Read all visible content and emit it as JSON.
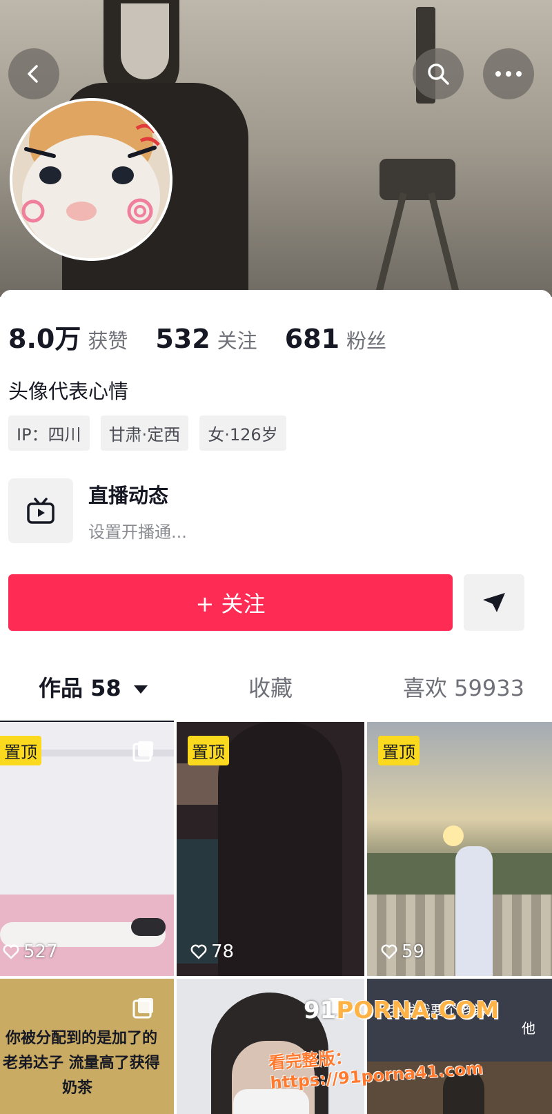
{
  "header": {
    "back_icon": "chevron-left-icon",
    "search_icon": "search-icon",
    "more_icon": "more-horizontal-icon"
  },
  "profile": {
    "stats": [
      {
        "value": "8.0万",
        "label": "获赞"
      },
      {
        "value": "532",
        "label": "关注"
      },
      {
        "value": "681",
        "label": "粉丝"
      }
    ],
    "bio": "头像代表心情",
    "tags": [
      "IP：四川",
      "甘肃·定西",
      "女·126岁"
    ]
  },
  "live": {
    "icon": "tv-icon",
    "title": "直播动态",
    "subtitle": "设置开播通..."
  },
  "actions": {
    "follow_label": "+ 关注",
    "share_icon": "send-icon"
  },
  "tabs": {
    "works": "作品 58",
    "favorites": "收藏",
    "likes": "喜欢 59933"
  },
  "grid": {
    "pin_label": "置顶",
    "tiles": [
      {
        "likes": "527"
      },
      {
        "likes": "78"
      },
      {
        "likes": "59"
      }
    ],
    "row2_overlay": [
      "你被分配到的是加了的",
      "老弟达子 流量高了获得",
      "奶茶"
    ],
    "row2_tile3_overlay": [
      "我发我要个老弟，",
      "他"
    ]
  },
  "watermark": {
    "site_prefix": "91",
    "site": "PORNA.COM",
    "line2": "看完整版：https://91porna41.com"
  },
  "colors": {
    "accent": "#fe2c55",
    "pin": "#fbd91f"
  }
}
